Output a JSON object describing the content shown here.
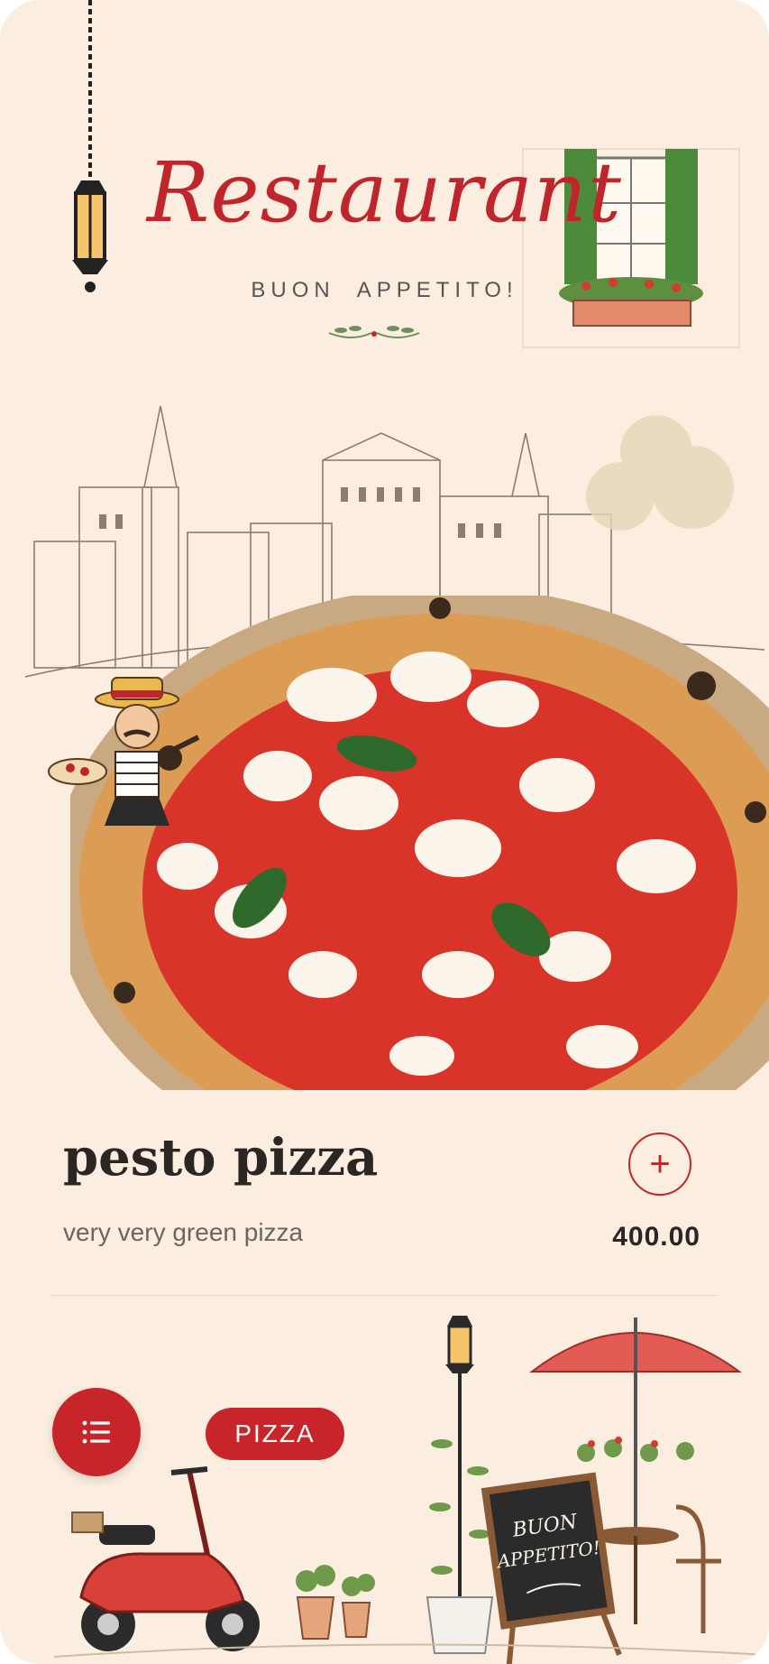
{
  "header": {
    "title": "Restaurant",
    "subtitle": "BUON  APPETITO!"
  },
  "product": {
    "name": "pesto pizza",
    "description": "very very green pizza",
    "price": "400.00",
    "add_symbol": "+"
  },
  "filter_chip": {
    "label": "PIZZA"
  },
  "sign": {
    "line1": "BUON",
    "line2": "APPETITO!"
  },
  "icons": {
    "add": "plus-icon",
    "menu": "list-icon"
  },
  "colors": {
    "accent": "#c8252a",
    "background": "#fbeee0",
    "text": "#2b2523",
    "muted": "#6b6663"
  }
}
